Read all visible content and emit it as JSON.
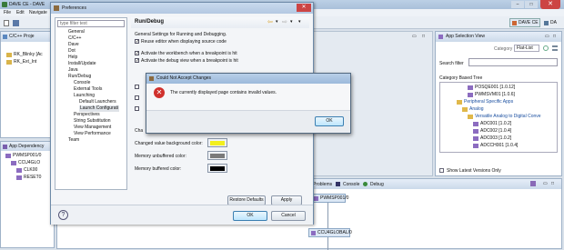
{
  "ide": {
    "title": "DAVE CE - DAVE",
    "menu": [
      "File",
      "Edit",
      "Navigate"
    ],
    "project_tab": "C/C++ Proje",
    "projects": [
      "RK_Blinky [Ac",
      "RK_Ext_Int"
    ],
    "dependency_tab": "App Dependency",
    "dependency_nodes": [
      "PWMSP001/0",
      "CCU4GLO",
      "CLK00",
      "RESET0"
    ],
    "perspective": "DAVE CE",
    "perspective2": "DA",
    "bottom_tabs": [
      "Problems",
      "Console",
      "Debug"
    ],
    "graph_nodes": [
      "PWMSP001/0",
      "CCU4GLOBAL/0"
    ]
  },
  "app_view": {
    "title": "App Selection View",
    "category_label": "Category",
    "category_value": "Flat-List",
    "search_label": "Search filter",
    "tree_label": "Category Based Tree",
    "tree": [
      "POSQE001 [1.0.12]",
      "PWMSVM01 [1.0.6]",
      "Peripheral Specific Apps",
      "Analog",
      "Versatile Analog to Digital Conve",
      "ADC001 [1.0.2]",
      "ADC002 [1.0.4]",
      "ADC003 [1.0.2]",
      "ADCCH001 [1.0.4]"
    ],
    "show_latest": "Show Latest Versions Only"
  },
  "prefs": {
    "title": "Preferences",
    "filter_placeholder": "type filter text",
    "nav": [
      "General",
      "C/C++",
      "Dave",
      "Dot",
      "Help",
      "Install/Update",
      "Java",
      "Run/Debug",
      "Console",
      "External Tools",
      "Launching",
      "Default Launchers",
      "Launch Configurati",
      "Perspectives",
      "String Substitution",
      "View Management",
      "View Performance",
      "Team"
    ],
    "page_title": "Run/Debug",
    "desc": "General Settings for Running and Debugging.",
    "checks": [
      "Reuse editor when displaying source code",
      "Activate the workbench when a breakpoint is hit",
      "Activate the debug view when a breakpoint is hit"
    ],
    "color_rows": [
      {
        "label": "Changed value background color:",
        "color": "#f2ef1e"
      },
      {
        "label": "Memory unbuffered color:",
        "color": "#7a7a7a"
      },
      {
        "label": "Memory buffered color:",
        "color": "#000000"
      }
    ],
    "partial_label": "Cha",
    "restore": "Restore Defaults",
    "apply": "Apply",
    "ok": "OK",
    "cancel": "Cancel"
  },
  "alert": {
    "title": "Could Not Accept Changes",
    "message": "The currently displayed page contains invalid values.",
    "ok": "OK"
  }
}
